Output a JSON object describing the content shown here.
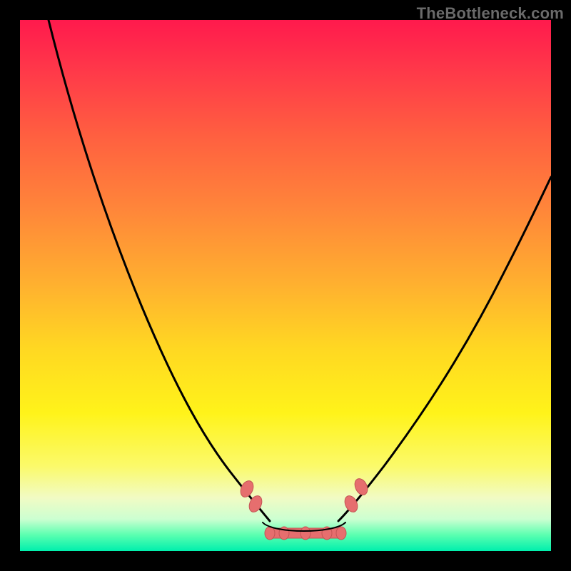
{
  "watermark": "TheBottleneck.com",
  "colors": {
    "background": "#000000",
    "curve": "#000000",
    "chain": "#e66e6e",
    "watermark_text": "#6a6a6a"
  },
  "chart_data": {
    "type": "line",
    "title": "",
    "xlabel": "",
    "ylabel": "",
    "xlim": [
      0,
      100
    ],
    "ylim": [
      0,
      100
    ],
    "grid": false,
    "legend": false,
    "series": [
      {
        "name": "bottleneck-curve",
        "x": [
          0,
          5,
          10,
          15,
          20,
          25,
          30,
          35,
          40,
          42,
          45,
          48,
          52,
          55,
          58,
          60,
          65,
          70,
          75,
          80,
          85,
          90,
          95,
          100
        ],
        "y": [
          100,
          90,
          80,
          70,
          60,
          50,
          40,
          30,
          18,
          12,
          6,
          2,
          2,
          2,
          6,
          12,
          22,
          32,
          42,
          52,
          60,
          66,
          72,
          78
        ]
      }
    ],
    "annotations": [
      {
        "name": "flat-trough-segment",
        "x_range": [
          44,
          58
        ],
        "y": 2,
        "style": "pink-chain-with-beads"
      },
      {
        "name": "left-bead-cluster",
        "x": 40,
        "y": 15
      },
      {
        "name": "left-bead-cluster-2",
        "x": 42,
        "y": 10
      },
      {
        "name": "right-bead-cluster",
        "x": 59,
        "y": 10
      },
      {
        "name": "right-bead-cluster-2",
        "x": 61,
        "y": 15
      }
    ]
  }
}
